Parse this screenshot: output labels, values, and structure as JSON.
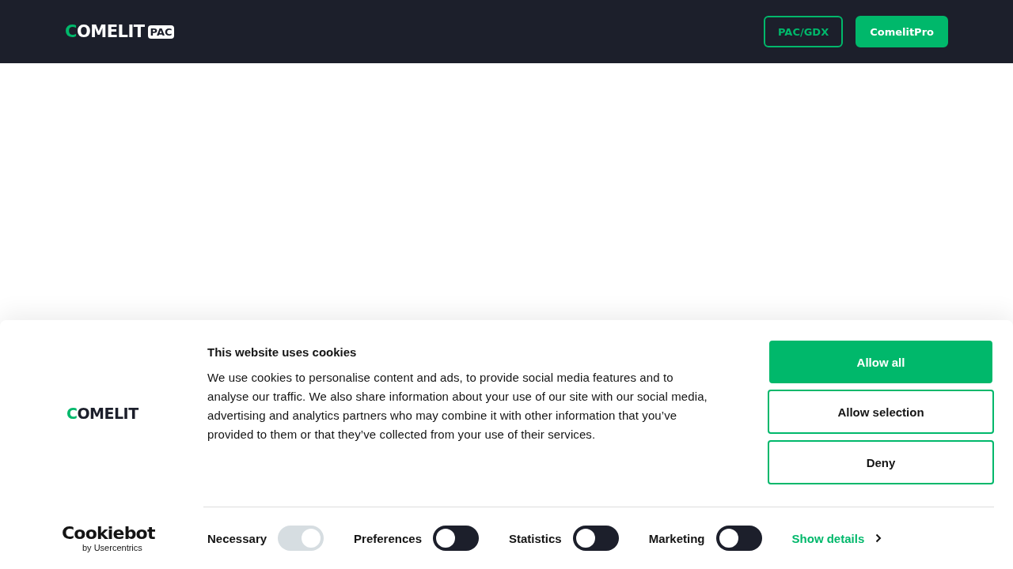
{
  "header": {
    "logo": {
      "brand": "COMELIT",
      "badge": "PAC"
    },
    "buttons": [
      {
        "label": "PAC/GDX",
        "kind": "outline"
      },
      {
        "label": "ComelitPro",
        "kind": "filled"
      }
    ]
  },
  "cookie_banner": {
    "brand_logo": "COMELIT",
    "provider_logo": {
      "name": "Cookiebot",
      "byline": "by Usercentrics"
    },
    "title": "This website uses cookies",
    "body": "We use cookies to personalise content and ads, to provide social media features and to analyse our traffic. We also share information about your use of our site with our social media, advertising and analytics partners who may combine it with other information that you’ve provided to them or that they’ve collected from your use of their services.",
    "buttons": [
      {
        "label": "Allow all",
        "kind": "filled"
      },
      {
        "label": "Allow selection",
        "kind": "outline"
      },
      {
        "label": "Deny",
        "kind": "outline"
      }
    ],
    "toggles": [
      {
        "label": "Necessary",
        "on": true,
        "disabled": true
      },
      {
        "label": "Preferences",
        "on": false,
        "disabled": false
      },
      {
        "label": "Statistics",
        "on": false,
        "disabled": false
      },
      {
        "label": "Marketing",
        "on": false,
        "disabled": false
      }
    ],
    "details_link": "Show details"
  }
}
